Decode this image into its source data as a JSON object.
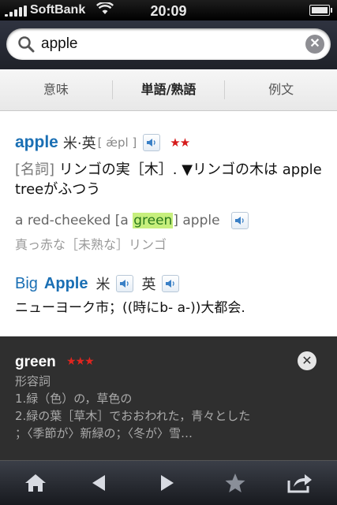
{
  "status_bar": {
    "carrier": "SoftBank",
    "time": "20:09"
  },
  "search": {
    "value": "apple",
    "placeholder": ""
  },
  "tabs": [
    {
      "label": "意味",
      "active": false
    },
    {
      "label": "単語/熟語",
      "active": true
    },
    {
      "label": "例文",
      "active": false
    }
  ],
  "entry": {
    "headword": "apple",
    "origin": "米·英",
    "pronunciation": "[ ǽpl ]",
    "rating": "★★",
    "pos": "[名詞]",
    "definition": " リンゴの実［木］. ▼リンゴの木は apple treeがふつう",
    "example_en_before": "a red-cheeked [a ",
    "example_en_highlight": "green",
    "example_en_after": "] apple",
    "example_ja": "真っ赤な［未熟な］リンゴ"
  },
  "entry2": {
    "word1": "Big",
    "word2": "Apple",
    "lang1": "米",
    "lang2": "英",
    "definition": "ニューヨーク市；((時にb- a-))大都会."
  },
  "popup": {
    "word": "green",
    "rating": "★★★",
    "pos": "形容詞",
    "line1": "1.緑（色）の，草色の",
    "line2": "2.緑の葉［草木］でおおわれた，青々とした",
    "line3": "；〈季節が〉新緑の；〈冬が〉雪…"
  },
  "colors": {
    "headword": "#1a6fb4",
    "highlight": "#c7ef7d",
    "star": "#d51a1a",
    "popup_bg": "#222222"
  },
  "icons": [
    "search-icon",
    "clear-icon",
    "speaker-icon",
    "close-icon",
    "home-icon",
    "back-icon",
    "forward-icon",
    "star-icon",
    "share-icon"
  ]
}
